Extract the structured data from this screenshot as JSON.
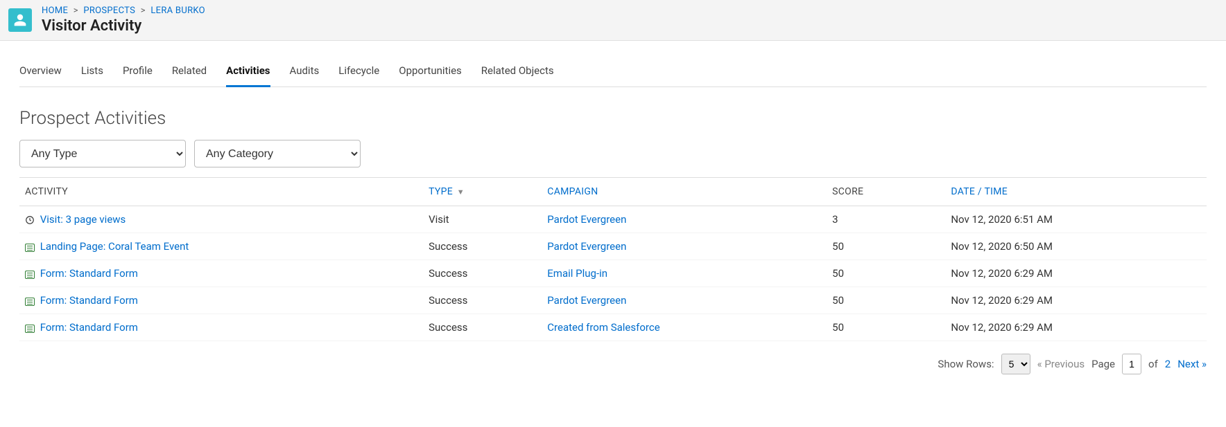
{
  "breadcrumb": {
    "home": "HOME",
    "prospects": "PROSPECTS",
    "name": "LERA BURKO"
  },
  "page_title": "Visitor Activity",
  "tabs": [
    {
      "label": "Overview",
      "active": false
    },
    {
      "label": "Lists",
      "active": false
    },
    {
      "label": "Profile",
      "active": false
    },
    {
      "label": "Related",
      "active": false
    },
    {
      "label": "Activities",
      "active": true
    },
    {
      "label": "Audits",
      "active": false
    },
    {
      "label": "Lifecycle",
      "active": false
    },
    {
      "label": "Opportunities",
      "active": false
    },
    {
      "label": "Related Objects",
      "active": false
    }
  ],
  "section_title": "Prospect Activities",
  "filters": {
    "type": "Any Type",
    "category": "Any Category"
  },
  "columns": {
    "activity": "ACTIVITY",
    "type": "TYPE",
    "campaign": "CAMPAIGN",
    "score": "SCORE",
    "datetime": "DATE / TIME"
  },
  "rows": [
    {
      "icon": "clock",
      "activity": "Visit: 3 page views",
      "type": "Visit",
      "campaign": "Pardot Evergreen",
      "score": "3",
      "datetime": "Nov 12, 2020 6:51 AM"
    },
    {
      "icon": "doc",
      "activity": "Landing Page: Coral Team Event",
      "type": "Success",
      "campaign": "Pardot Evergreen",
      "score": "50",
      "datetime": "Nov 12, 2020 6:50 AM"
    },
    {
      "icon": "doc",
      "activity": "Form: Standard Form",
      "type": "Success",
      "campaign": "Email Plug-in",
      "score": "50",
      "datetime": "Nov 12, 2020 6:29 AM"
    },
    {
      "icon": "doc",
      "activity": "Form: Standard Form",
      "type": "Success",
      "campaign": "Pardot Evergreen",
      "score": "50",
      "datetime": "Nov 12, 2020 6:29 AM"
    },
    {
      "icon": "doc",
      "activity": "Form: Standard Form",
      "type": "Success",
      "campaign": "Created from Salesforce",
      "score": "50",
      "datetime": "Nov 12, 2020 6:29 AM"
    }
  ],
  "pager": {
    "show_rows_label": "Show Rows:",
    "rows_per_page": "5",
    "prev_label": "« Previous",
    "page_label": "Page",
    "page_current": "1",
    "of_label": "of",
    "page_total": "2",
    "next_label": "Next »"
  }
}
